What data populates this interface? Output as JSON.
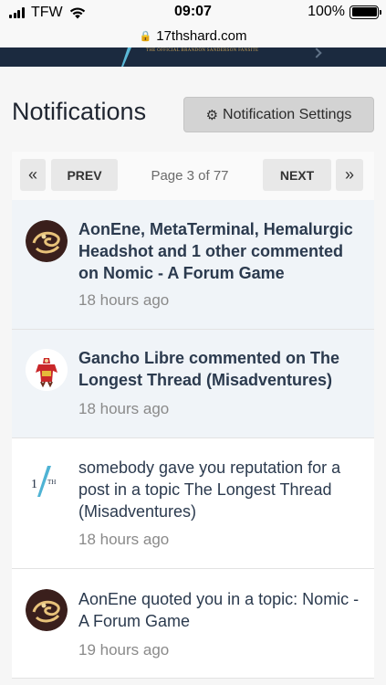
{
  "status_bar": {
    "carrier": "TFW",
    "time": "09:07",
    "battery": "100%",
    "battery_level": 1.0
  },
  "browser": {
    "url": "17thshard.com"
  },
  "site_header": {
    "tagline": "THE OFFICIAL BRANDON SANDERSON FANSITE"
  },
  "page": {
    "title": "Notifications",
    "settings_button": "Notification Settings"
  },
  "pagination": {
    "first_icon": "«",
    "prev_label": "PREV",
    "page_label": "Page 3 of 77",
    "next_label": "NEXT",
    "last_icon": "»"
  },
  "notifications": [
    {
      "text": "AonEne, MetaTerminal, Hemalurgic Headshot and 1 other commented on Nomic - A Forum Game",
      "time": "18 hours ago",
      "unread": true,
      "avatar": "aonene-avatar"
    },
    {
      "text": "Gancho Libre commented on The Longest Thread (Misadventures)",
      "time": "18 hours ago",
      "unread": true,
      "avatar": "gancho-libre-avatar"
    },
    {
      "text": "somebody gave you reputation for a post in a topic The Longest Thread (Misadventures)",
      "time": "18 hours ago",
      "unread": false,
      "avatar": "17th-shard-logo-avatar"
    },
    {
      "text": "AonEne quoted you in a topic: Nomic - A Forum Game",
      "time": "19 hours ago",
      "unread": false,
      "avatar": "aonene-avatar"
    }
  ],
  "colors": {
    "header_bg": "#1b2a3f",
    "unread_bg": "#f0f4f8",
    "text": "#2b3a4e",
    "muted": "#8a8a8a"
  }
}
